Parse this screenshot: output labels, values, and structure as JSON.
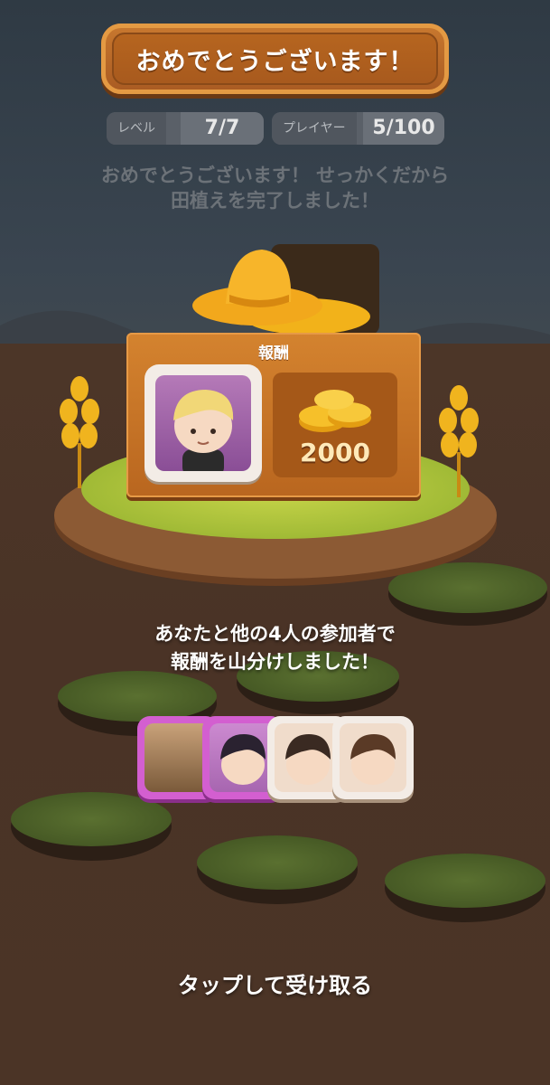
{
  "header": {
    "title": "おめでとうございます！"
  },
  "stats": {
    "level_label": "レベル",
    "level_value": "7/7",
    "player_label": "プレイヤー",
    "player_value": "5/100"
  },
  "subtitle": {
    "line1": "おめでとうございます！ せっかくだから",
    "line2": "田植えを完了しました！"
  },
  "reward": {
    "label": "報酬",
    "amount": "2000",
    "icon": "gold-coins-icon"
  },
  "share_message": {
    "line1": "あなたと他の4人の参加者で",
    "line2": "報酬を山分けしました！"
  },
  "participants": [
    {
      "name": "participant-1",
      "frame_color": "#d35fd0"
    },
    {
      "name": "participant-2",
      "frame_color": "#d35fd0"
    },
    {
      "name": "participant-3",
      "frame_color": "#f3ece6"
    },
    {
      "name": "participant-4",
      "frame_color": "#f3ece6"
    }
  ],
  "cta": {
    "label": "タップして受け取る"
  },
  "colors": {
    "banner": "#b6651f",
    "board": "#c97328",
    "ground": "#4a3426",
    "text": "#ffffff"
  }
}
